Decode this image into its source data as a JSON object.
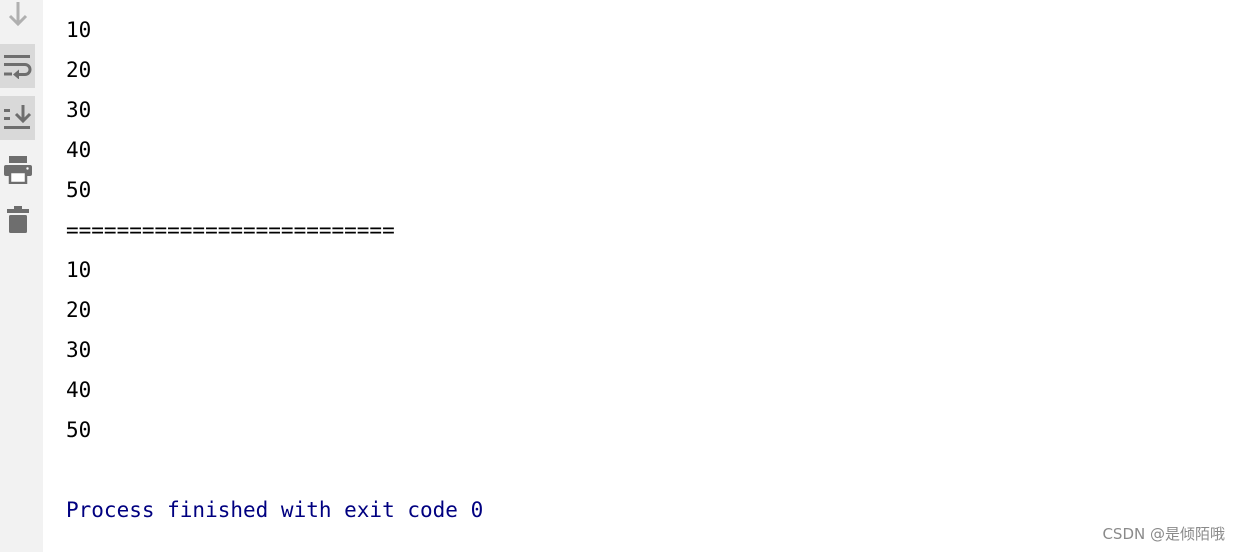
{
  "toolbar": {
    "icons": [
      {
        "name": "scroll-down-arrow-icon",
        "active": false
      },
      {
        "name": "soft-wrap-icon",
        "active": true
      },
      {
        "name": "scroll-to-end-icon",
        "active": true
      },
      {
        "name": "print-icon",
        "active": false
      },
      {
        "name": "clear-all-icon",
        "active": false
      }
    ],
    "icon_color": "#6e6e6e"
  },
  "console": {
    "lines": [
      "10",
      "20",
      "30",
      "40",
      "50",
      "==========================",
      "10",
      "20",
      "30",
      "40",
      "50"
    ],
    "process_message": "Process finished with exit code 0",
    "output_color": "#000000",
    "process_color": "#000080"
  },
  "watermark": "CSDN @是倾陌哦"
}
